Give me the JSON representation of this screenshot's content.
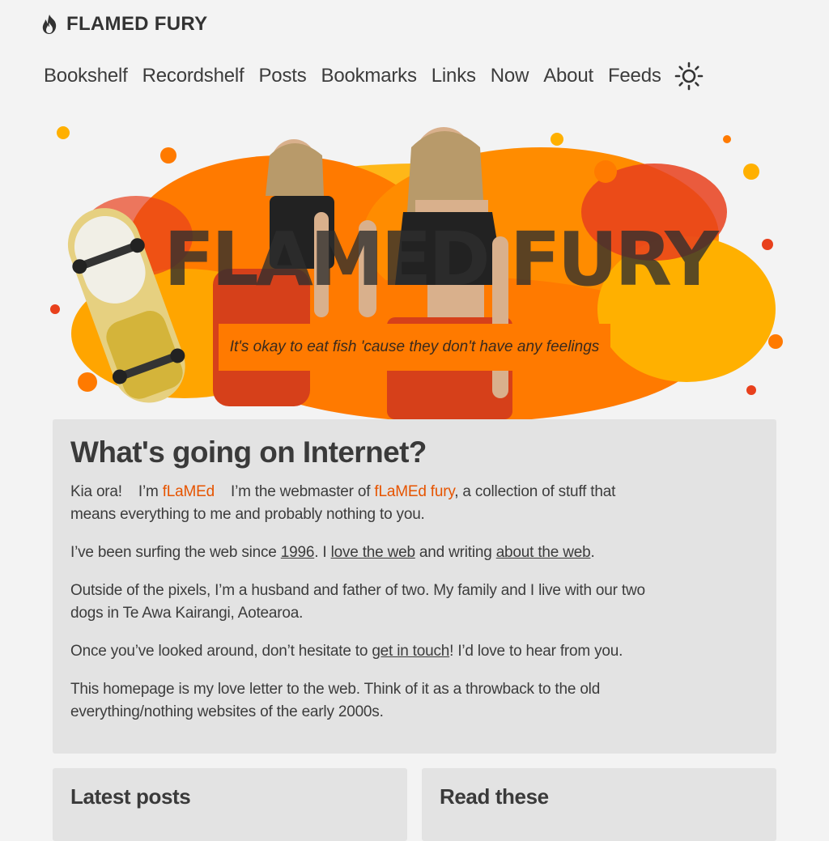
{
  "site": {
    "title": "FLAMED FURY",
    "logo_icon": "flame-icon"
  },
  "nav": {
    "items": [
      "Bookshelf",
      "Recordshelf",
      "Posts",
      "Bookmarks",
      "Links",
      "Now",
      "About",
      "Feeds"
    ],
    "theme_icon": "sun-icon"
  },
  "hero": {
    "overlay_text": "FLAMED FURY",
    "tagline": "It's okay to eat fish 'cause they don't have any feelings",
    "colors": {
      "orange": "#ff7a00",
      "yellow": "#ffb000",
      "red": "#e8401c"
    }
  },
  "intro": {
    "heading": "What's going on Internet?",
    "p1": {
      "a": "Kia ora!",
      "b": "I’m ",
      "name": "fLaMEd",
      "c": "I’m the webmaster of ",
      "site": "fLaMEd fury",
      "d": ", a collection of stuff that means everything to me and probably nothing to you."
    },
    "p2": {
      "a": "I’ve been surfing the web since ",
      "year": "1996",
      "b": ". I ",
      "love": "love the web",
      "c": " and writing ",
      "about": "about the web",
      "d": "."
    },
    "p3": "Outside of the pixels, I’m a husband and father of two. My family and I live with our two dogs in Te Awa Kairangi, Aotearoa.",
    "p4": {
      "a": "Once you’ve looked around, don’t hesitate to ",
      "link": "get in touch",
      "b": "! I’d love to hear from you."
    },
    "p5": "This homepage is my love letter to the web. Think of it as a throwback to the old everything/nothing websites of the early 2000s."
  },
  "sections": {
    "latest_posts": "Latest posts",
    "read_these": "Read these"
  },
  "colors": {
    "accent": "#e65400",
    "background": "#f3f3f3",
    "card": "#e3e3e3"
  }
}
